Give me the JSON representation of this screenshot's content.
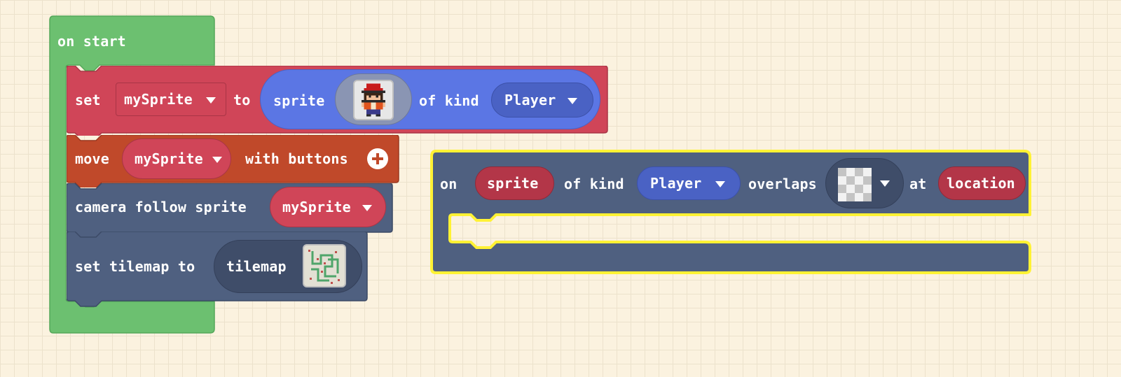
{
  "colors": {
    "workspace_bg": "#fbf2df",
    "grid_line": "#ece2cc",
    "loops_green": "#6cc070",
    "variables_red": "#d04558",
    "sprites_blue": "#5b76e4",
    "controller_orange": "#c0492a",
    "scene_slate": "#4f6080",
    "selection_yellow": "#fff234"
  },
  "on_start": {
    "label": "on start",
    "set_block": {
      "set_label": "set",
      "variable": "mySprite",
      "to_label": "to",
      "sprite_label": "sprite",
      "of_kind_label": "of kind",
      "kind": "Player",
      "image_icon": "player-sprite-icon"
    },
    "move_block": {
      "move_label": "move",
      "variable": "mySprite",
      "with_buttons_label": "with buttons",
      "expand_icon": "plus-circle-icon"
    },
    "camera_block": {
      "label": "camera follow sprite",
      "variable": "mySprite"
    },
    "tilemap_block": {
      "label": "set tilemap to",
      "tilemap_label": "tilemap",
      "image_icon": "tilemap-thumbnail-icon"
    }
  },
  "overlap_event": {
    "on_label": "on",
    "sprite_param": "sprite",
    "of_kind_label": "of kind",
    "kind": "Player",
    "overlaps_label": "overlaps",
    "tile_icon": "transparent-tile-icon",
    "at_label": "at",
    "location_param": "location"
  }
}
